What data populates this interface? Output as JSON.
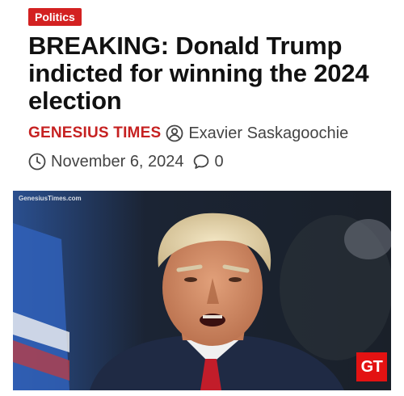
{
  "article": {
    "category": "Politics",
    "headline": "BREAKING: Donald Trump indicted for winning the 2024 election",
    "site_name": "GENESIUS TIMES",
    "author": "Exavier Saskagoochie",
    "date": "November 6, 2024",
    "comment_count": "0"
  },
  "image": {
    "watermark": "GenesiusTimes.com",
    "badge": "GT"
  },
  "icons": {
    "author": "user-circle-icon",
    "date": "clock-icon",
    "comments": "comment-bubble-icon"
  },
  "colors": {
    "accent": "#c62121",
    "category_bg": "#d32121",
    "badge_bg": "#e31212",
    "text_meta": "#444444"
  }
}
